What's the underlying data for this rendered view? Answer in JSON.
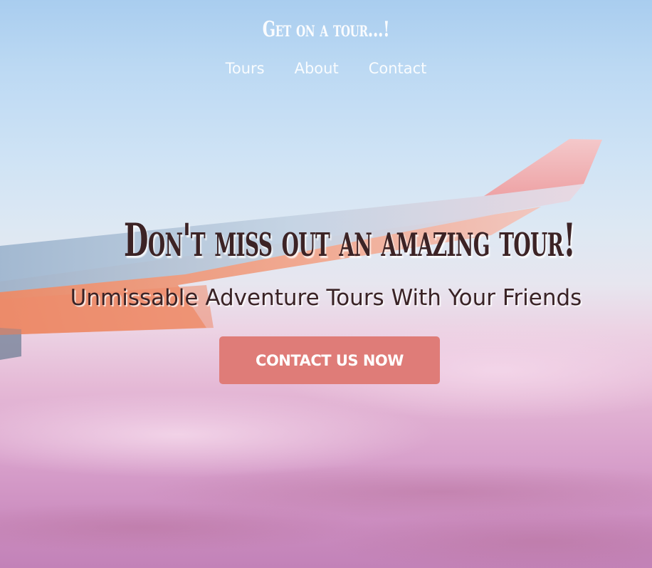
{
  "header": {
    "logo_text": "Get on a tour...!"
  },
  "nav": {
    "items": [
      {
        "label": "Tours"
      },
      {
        "label": "About"
      },
      {
        "label": "Contact"
      }
    ]
  },
  "hero": {
    "headline": "Don't miss out an amazing tour!",
    "subheadline": "Unmissable Adventure Tours With Your Friends",
    "cta_label": "CONTACT US NOW"
  },
  "colors": {
    "cta_background": "#df7c78",
    "headline_text": "#3c2325",
    "nav_text": "#ffffff"
  }
}
